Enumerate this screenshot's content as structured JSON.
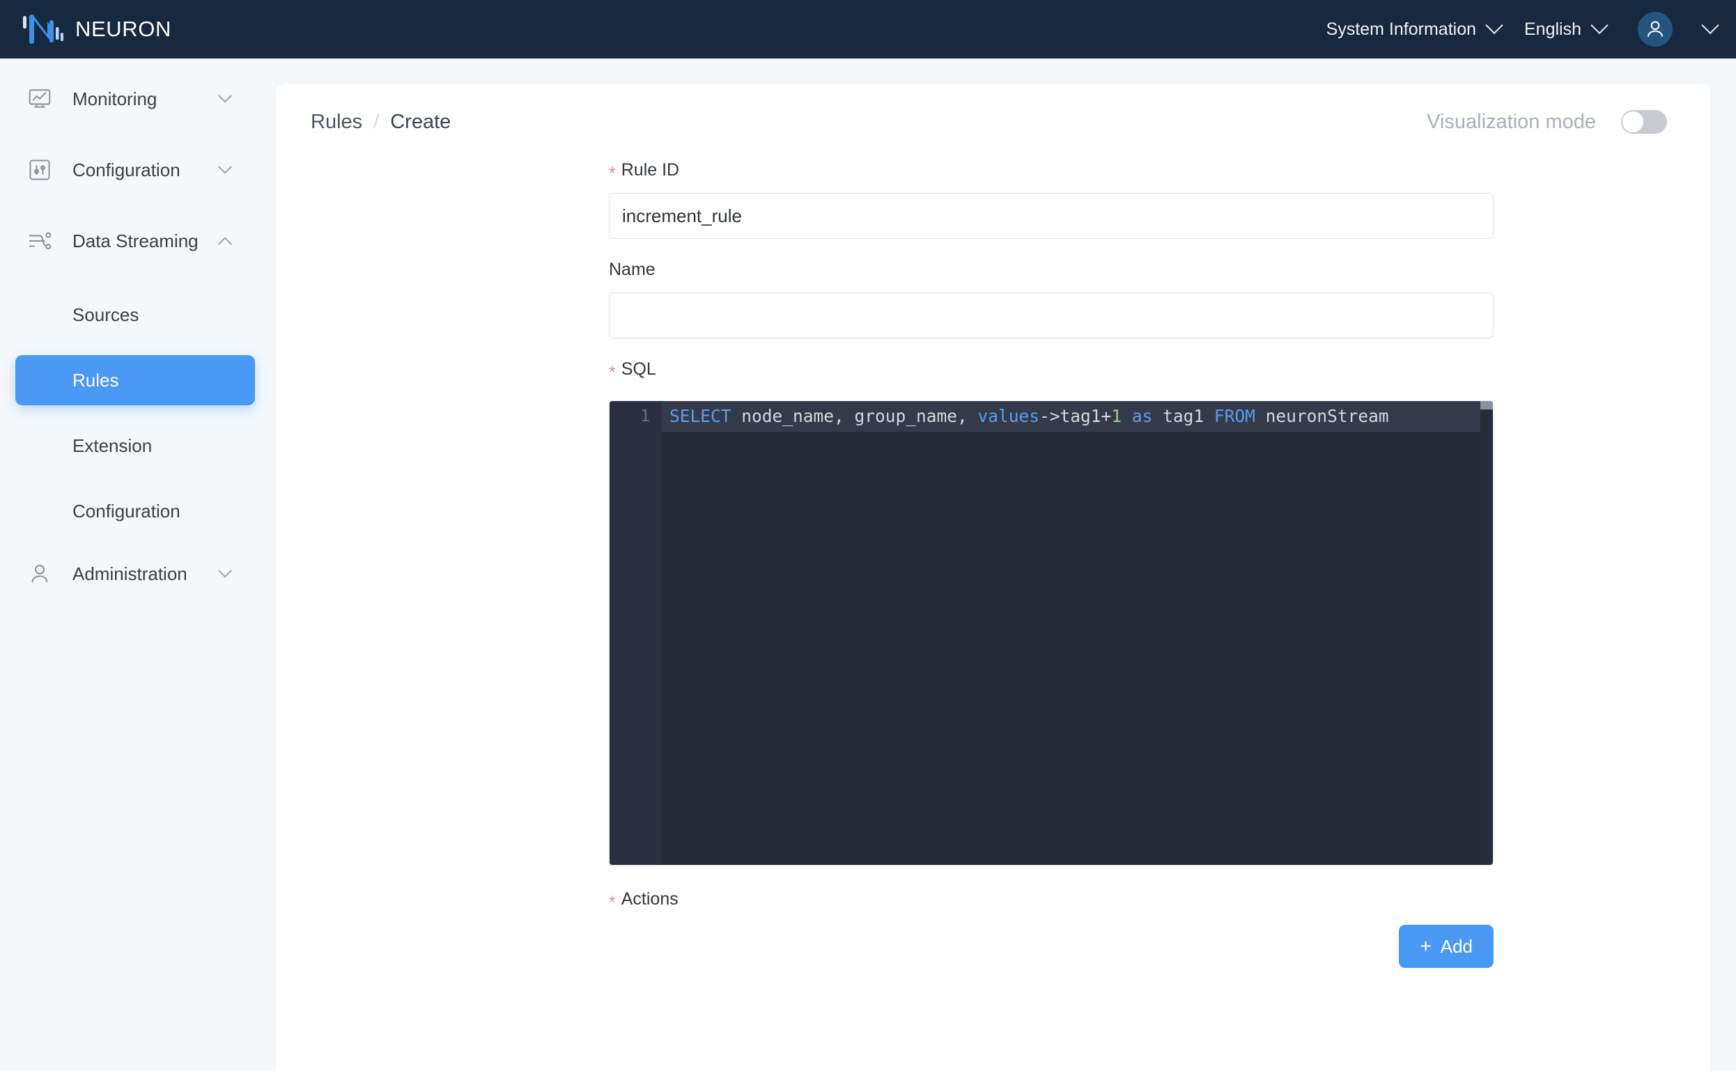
{
  "header": {
    "brand": "NEURON",
    "logo_icon": "neuron-logo-icon",
    "system_information": "System Information",
    "language": "English",
    "user_icon": "user-avatar-icon"
  },
  "sidebar": {
    "groups": [
      {
        "label": "Monitoring",
        "icon": "monitor-chart-icon",
        "expanded": false
      },
      {
        "label": "Configuration",
        "icon": "sliders-icon",
        "expanded": false
      },
      {
        "label": "Data Streaming",
        "icon": "data-stream-icon",
        "expanded": true
      }
    ],
    "data_streaming_items": [
      {
        "label": "Sources",
        "active": false
      },
      {
        "label": "Rules",
        "active": true
      },
      {
        "label": "Extension",
        "active": false
      },
      {
        "label": "Configuration",
        "active": false
      }
    ],
    "administration": {
      "label": "Administration",
      "icon": "person-icon",
      "expanded": false
    }
  },
  "main": {
    "breadcrumb": {
      "parent": "Rules",
      "separator": "/",
      "current": "Create"
    },
    "visualization_mode": {
      "label": "Visualization mode",
      "enabled": false
    },
    "form": {
      "rule_id": {
        "label": "Rule ID",
        "required": true,
        "value": "increment_rule",
        "placeholder": ""
      },
      "name": {
        "label": "Name",
        "required": false,
        "value": "",
        "placeholder": ""
      },
      "sql": {
        "label": "SQL",
        "required": true,
        "line_number": "1",
        "code": "SELECT node_name, group_name, values->tag1+1 as tag1 FROM neuronStream",
        "tokens": [
          {
            "t": "SELECT",
            "c": "kw"
          },
          {
            "t": " node_name, group_name, ",
            "c": "plain"
          },
          {
            "t": "values",
            "c": "kw"
          },
          {
            "t": "->tag1+",
            "c": "plain"
          },
          {
            "t": "1",
            "c": "num"
          },
          {
            "t": " ",
            "c": "plain"
          },
          {
            "t": "as",
            "c": "kw"
          },
          {
            "t": " tag1 ",
            "c": "plain"
          },
          {
            "t": "FROM",
            "c": "kw"
          },
          {
            "t": " neuronStream",
            "c": "plain"
          }
        ]
      },
      "actions": {
        "label": "Actions",
        "required": true,
        "add_button": "Add",
        "add_icon": "plus-icon"
      }
    }
  },
  "colors": {
    "header_bg": "#17293f",
    "accent": "#4a9af5",
    "sidebar_bg": "#f4f8fb",
    "editor_bg": "#262b38",
    "required_star": "#e08a96"
  }
}
